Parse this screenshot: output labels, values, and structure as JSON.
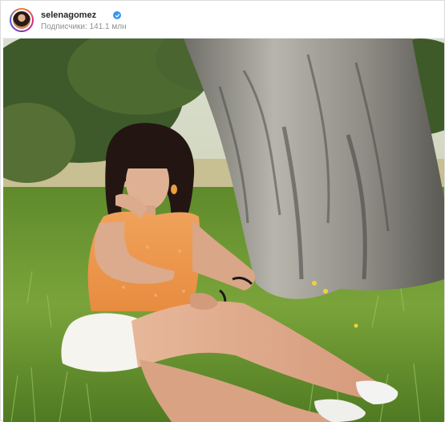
{
  "profile": {
    "username": "selenagomez",
    "followers_text": "Подписчики: 141.1 млн"
  },
  "icons": {
    "verified": "verified-badge-icon",
    "avatar": "profile-avatar"
  },
  "colors": {
    "verified_blue": "#3897f0",
    "username_text": "#262626",
    "secondary_text": "#8e8e8e"
  }
}
